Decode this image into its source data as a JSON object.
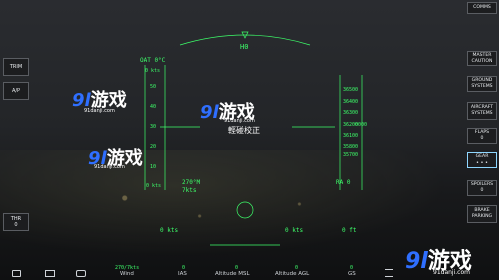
{
  "hud": {
    "heading_value": "H0",
    "oat": "OAT 0°C",
    "airspeed_ref": "0 kts",
    "airspeed_tick_top": "50",
    "airspeed_ticks": [
      "50",
      "40",
      "30",
      "20",
      "10"
    ],
    "airspeed_current": "0 kts",
    "wind_dir": "270°M",
    "wind_speed": "7kts",
    "altitude_ticks": [
      "36500",
      "36400",
      "36300",
      "36200",
      "36100",
      "35800",
      "35700"
    ],
    "altitude_current": "0000",
    "ra": "RA 0",
    "altitude_bottom": "0 ft",
    "caption": "輕碰校正",
    "ias_left": "0 kts",
    "ias_right": "0 kts"
  },
  "left_panel": {
    "trim": "TRIM",
    "ap": "A/P",
    "thr_label": "THR",
    "thr_value": "0"
  },
  "right_panel": {
    "comms": "COMMS",
    "master_caution": "MASTER CAUTION",
    "ground_systems": "GROUND SYSTEMS",
    "aircraft_systems": "AIRCRAFT SYSTEMS",
    "flaps_label": "FLAPS",
    "flaps_value": "0",
    "gear": "GEAR",
    "spoilers_label": "SPOILERS",
    "spoilers_value": "0",
    "brake_label": "BRAKE PARKING"
  },
  "bottom_bar": {
    "wind_value": "270/7kts",
    "wind_label": "Wind",
    "ias_value": "0",
    "ias_label": "IAS",
    "alt_msl_value": "0",
    "alt_msl_label": "Altitude MSL",
    "alt_agl_value": "0",
    "alt_agl_label": "Altitude AGL",
    "gs_value": "0",
    "gs_label": "GS"
  },
  "watermarks": {
    "brand_num": "9l",
    "brand_cn": "游戏",
    "site": "91danji.com",
    "site_alt": "91danji.com"
  },
  "icons": [
    "camera-icon",
    "view-icon",
    "vehicle-icon",
    "menu-icon"
  ],
  "colors": {
    "hud_green": "#3dff6a",
    "panel_bg": "#1c1d1f",
    "gear_active_border": "#8fd7ff",
    "watermark_blue": "#2f6fff"
  }
}
